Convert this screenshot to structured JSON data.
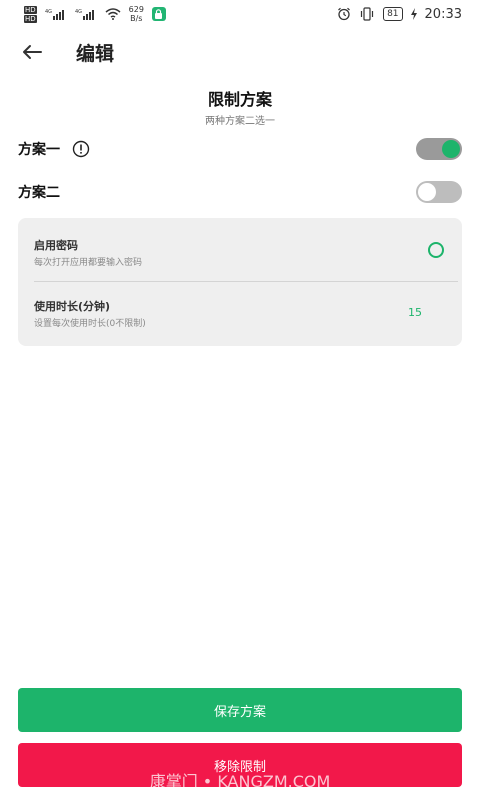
{
  "status_bar": {
    "hd1": "HD",
    "hd2": "HD",
    "net_speed_value": "629",
    "net_speed_unit": "B/s",
    "battery": "81",
    "time": "20:33"
  },
  "header": {
    "title": "编辑"
  },
  "page": {
    "title": "限制方案",
    "subtitle": "两种方案二选一"
  },
  "plans": [
    {
      "label": "方案一",
      "enabled": true
    },
    {
      "label": "方案二",
      "enabled": false
    }
  ],
  "settings": {
    "password": {
      "title": "启用密码",
      "desc": "每次打开应用都要输入密码"
    },
    "duration": {
      "title": "使用时长(分钟)",
      "desc": "设置每次使用时长(0不限制)",
      "value": "15"
    }
  },
  "buttons": {
    "save": "保存方案",
    "remove": "移除限制"
  },
  "watermark": "康掌门 • KANGZM.COM",
  "colors": {
    "accent": "#1db46b",
    "danger": "#f2184a",
    "card_bg": "#efefef"
  }
}
